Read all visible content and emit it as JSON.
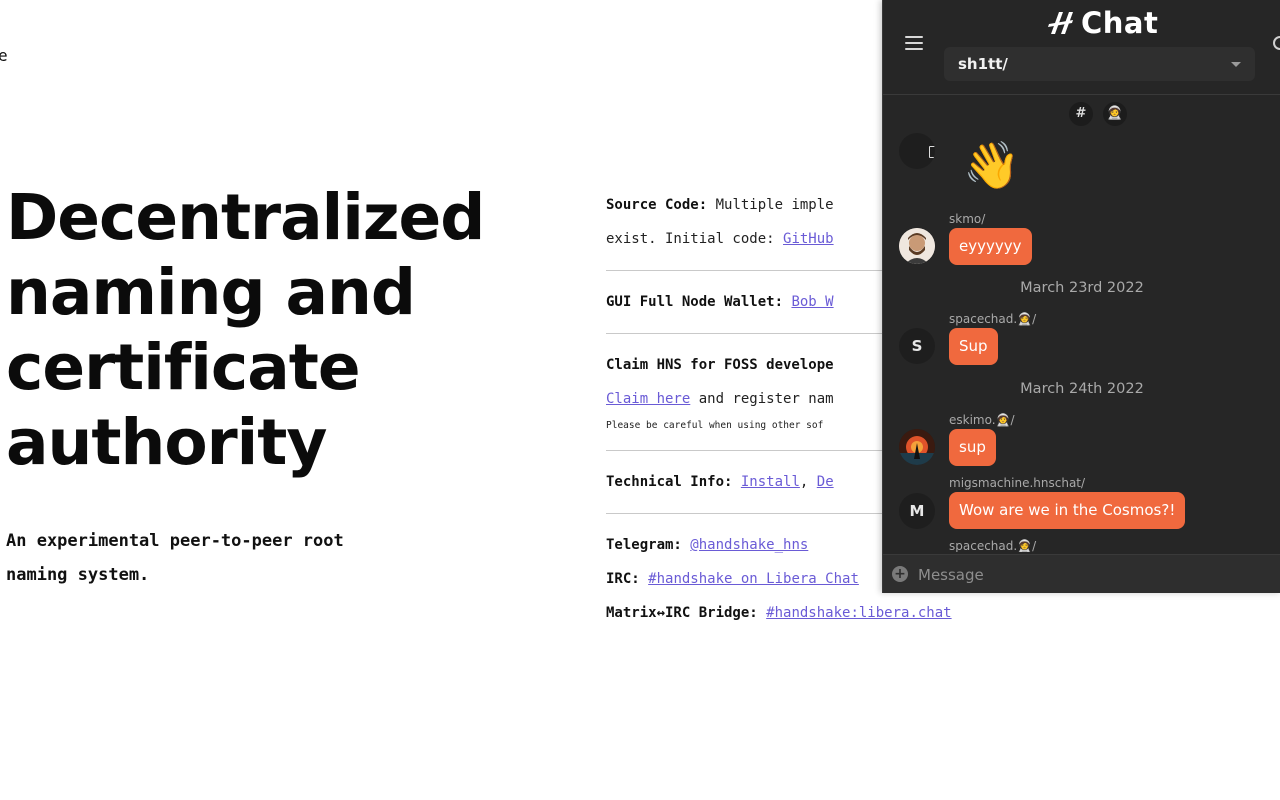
{
  "page": {
    "edge_char": "e",
    "hero_title_lines": [
      "Decentralized",
      "naming and",
      "certificate",
      "authority"
    ],
    "hero_subtitle_lines": [
      "An experimental peer-to-peer root",
      "naming system."
    ]
  },
  "info": {
    "source_label": "Source Code:",
    "source_text_1": "Multiple imple",
    "source_text_2": "exist. Initial code:",
    "source_link": "GitHub",
    "wallet_label": "GUI Full Node Wallet:",
    "wallet_link": "Bob W",
    "claim_label": "Claim HNS for FOSS develope",
    "claim_link": "Claim here",
    "claim_text": "and register nam",
    "careful_text": "Please be careful when using other sof",
    "tech_label": "Technical Info:",
    "tech_link_1": "Install",
    "tech_sep": ",",
    "tech_link_2": "De",
    "telegram_label": "Telegram:",
    "telegram_link": "@handshake_hns",
    "irc_label": "IRC:",
    "irc_link": "#handshake on Libera Chat",
    "matrix_label": "Matrix↔IRC Bridge:",
    "matrix_link": "#handshake:libera.chat"
  },
  "chat": {
    "brand": "Chat",
    "domain_selected": "sh1tt/",
    "toggle_channel": "#",
    "toggle_astronaut": "🧑‍🚀",
    "wave_emoji": "👋",
    "messages": [
      {
        "user": "skmo/",
        "text": "eyyyyyy"
      },
      {
        "date": "March 23rd 2022"
      },
      {
        "user": "spacechad.🧑‍🚀/",
        "avatar_letter": "S",
        "text": "Sup"
      },
      {
        "date": "March 24th 2022"
      },
      {
        "user": "eskimo.🧑‍🚀/",
        "text": "sup"
      },
      {
        "user": "migsmachine.hnschat/",
        "avatar_letter": "M",
        "text": "Wow are we in the Cosmos?!"
      },
      {
        "user": "spacechad.🧑‍🚀/"
      }
    ],
    "composer_placeholder": "Message"
  },
  "colors": {
    "bubble": "#f0693e",
    "link": "#6a5bd6",
    "panel": "#262626"
  }
}
